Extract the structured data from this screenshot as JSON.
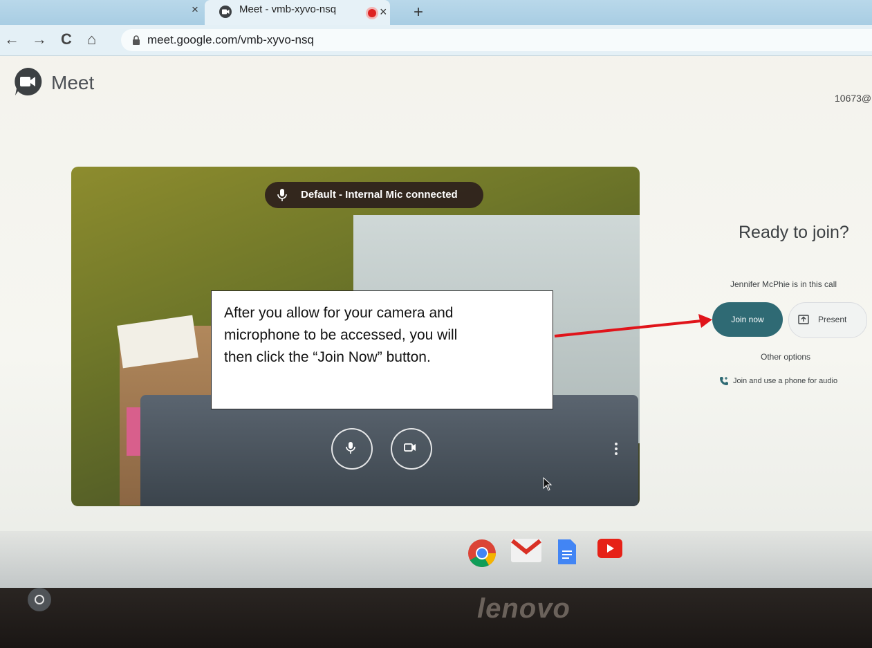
{
  "browser": {
    "tab_title": "Meet - vmb-xyvo-nsq",
    "tab_close_glyph": "×",
    "new_tab_glyph": "+",
    "url": "meet.google.com/vmb-xyvo-nsq",
    "nav": {
      "back": "←",
      "forward": "→",
      "reload": "C",
      "home": "⌂"
    }
  },
  "meet": {
    "app_name": "Meet",
    "account": "10673@",
    "mic_status": "Default - Internal Mic  connected",
    "ready_title": "Ready to join?",
    "in_call": "Jennifer McPhie is in this call",
    "join_button": "Join now",
    "present_button": "Present",
    "other_options": "Other options",
    "phone_option": "Join and use a phone for audio"
  },
  "callout": {
    "text_line1": "After you allow for your camera and",
    "text_line2": "microphone to be accessed, you will",
    "text_line3": "then click the “Join Now” button."
  },
  "hardware": {
    "brand": "lenovo"
  },
  "icons": {
    "meet_logo": "meet-camera-bubble",
    "mic": "microphone-icon",
    "camera": "video-camera-icon",
    "present": "present-screen-icon",
    "phone": "phone-add-icon"
  },
  "colors": {
    "join_button": "#2f6a74",
    "arrow": "#e0141a",
    "tab_strip": "#b9d8ea"
  }
}
